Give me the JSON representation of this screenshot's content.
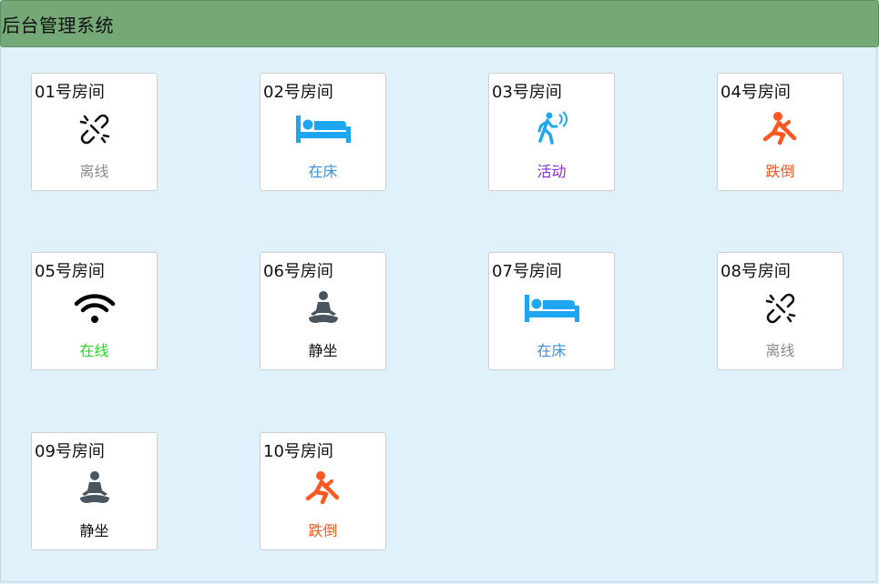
{
  "header": {
    "title": "后台管理系统"
  },
  "colors": {
    "header_bg": "#74a876",
    "page_bg": "#dff1fb",
    "offline": "#8a8a8a",
    "in_bed": "#3a8fdc",
    "active": "#8a2be2",
    "fall": "#ff5722",
    "online": "#22dd22",
    "meditate": "#111111"
  },
  "rooms": [
    {
      "name": "01号房间",
      "status": "离线",
      "icon": "broken-link-icon"
    },
    {
      "name": "02号房间",
      "status": "在床",
      "icon": "bed-icon"
    },
    {
      "name": "03号房间",
      "status": "活动",
      "icon": "walking-person-icon"
    },
    {
      "name": "04号房间",
      "status": "跌倒",
      "icon": "falling-person-icon"
    },
    {
      "name": "05号房间",
      "status": "在线",
      "icon": "wifi-icon"
    },
    {
      "name": "06号房间",
      "status": "静坐",
      "icon": "meditation-icon"
    },
    {
      "name": "07号房间",
      "status": "在床",
      "icon": "bed-icon"
    },
    {
      "name": "08号房间",
      "status": "离线",
      "icon": "broken-link-icon"
    },
    {
      "name": "09号房间",
      "status": "静坐",
      "icon": "meditation-icon"
    },
    {
      "name": "10号房间",
      "status": "跌倒",
      "icon": "falling-person-icon"
    }
  ]
}
